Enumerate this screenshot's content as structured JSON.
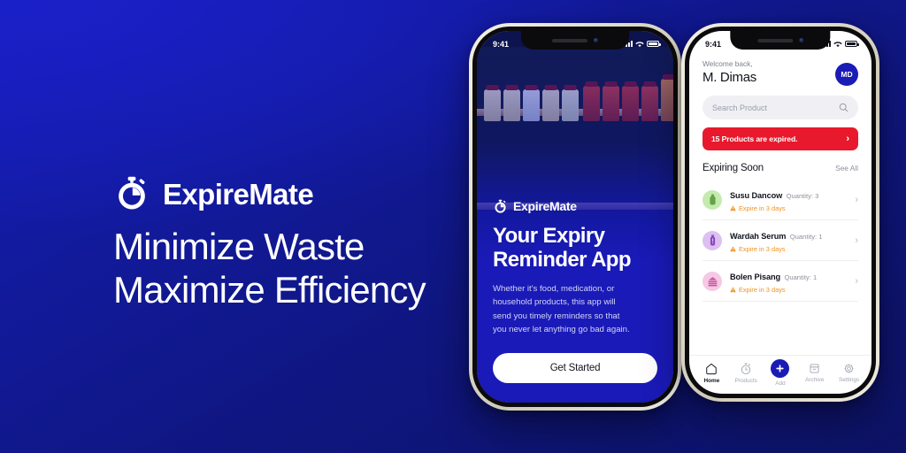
{
  "brand": {
    "logo_icon": "stopwatch-icon",
    "name": "ExpireMate",
    "headline": "Minimize Waste\nMaximize Efficiency"
  },
  "colors": {
    "background_blue": "#151cb4",
    "background_blue_dark": "#0d1264",
    "accent_blue": "#1b1bb5",
    "screen_blue": "#1a1ab8",
    "alert_red": "#e8192c",
    "warning_orange": "#f0921e"
  },
  "phone_left": {
    "status_bar": {
      "time": "9:41",
      "signal_icon": "signal-bars-icon",
      "wifi_icon": "wifi-icon",
      "battery_icon": "battery-icon"
    },
    "background_image": "grocery-shelf-photo",
    "logo_icon": "stopwatch-icon",
    "brand": "ExpireMate",
    "title": "Your Expiry\nReminder App",
    "body": "Whether it's food, medication, or\nhousehold products, this app will\nsend you timely reminders so that\nyou never let anything go bad again.",
    "cta_label": "Get Started"
  },
  "phone_right": {
    "status_bar": {
      "time": "9:41",
      "signal_icon": "signal-bars-icon",
      "wifi_icon": "wifi-icon",
      "battery_icon": "battery-icon"
    },
    "welcome_label": "Welcome back,",
    "user_name": "M. Dimas",
    "avatar_initials": "MD",
    "search": {
      "placeholder": "Search Product",
      "icon": "search-icon"
    },
    "alert": {
      "text": "15 Products are expired.",
      "chevron_icon": "chevron-right-icon"
    },
    "section": {
      "title": "Expiring Soon",
      "see_all_label": "See All"
    },
    "products": [
      {
        "name": "Susu Dancow",
        "quantity_label": "Quantity: 3",
        "expiry_label": "Expire in 3 days",
        "icon": "milk-bottle-icon",
        "icon_bg": "#c5eab0",
        "icon_fg": "#62a544"
      },
      {
        "name": "Wardah Serum",
        "quantity_label": "Quantity: 1",
        "expiry_label": "Expire in 3 days",
        "icon": "serum-bottle-icon",
        "icon_bg": "#dcc0f0",
        "icon_fg": "#8b46c4"
      },
      {
        "name": "Bolen Pisang",
        "quantity_label": "Quantity: 1",
        "expiry_label": "Expire in 3 days",
        "icon": "layered-cake-icon",
        "icon_bg": "#f6c8e4",
        "icon_fg": "#c75aa2"
      }
    ],
    "tabs": [
      {
        "label": "Home",
        "icon": "home-icon",
        "active": true
      },
      {
        "label": "Products",
        "icon": "stopwatch-icon",
        "active": false
      },
      {
        "label": "Add",
        "icon": "plus-icon",
        "active": false
      },
      {
        "label": "Archive",
        "icon": "archive-box-icon",
        "active": false
      },
      {
        "label": "Settings",
        "icon": "gear-icon",
        "active": false
      }
    ]
  }
}
